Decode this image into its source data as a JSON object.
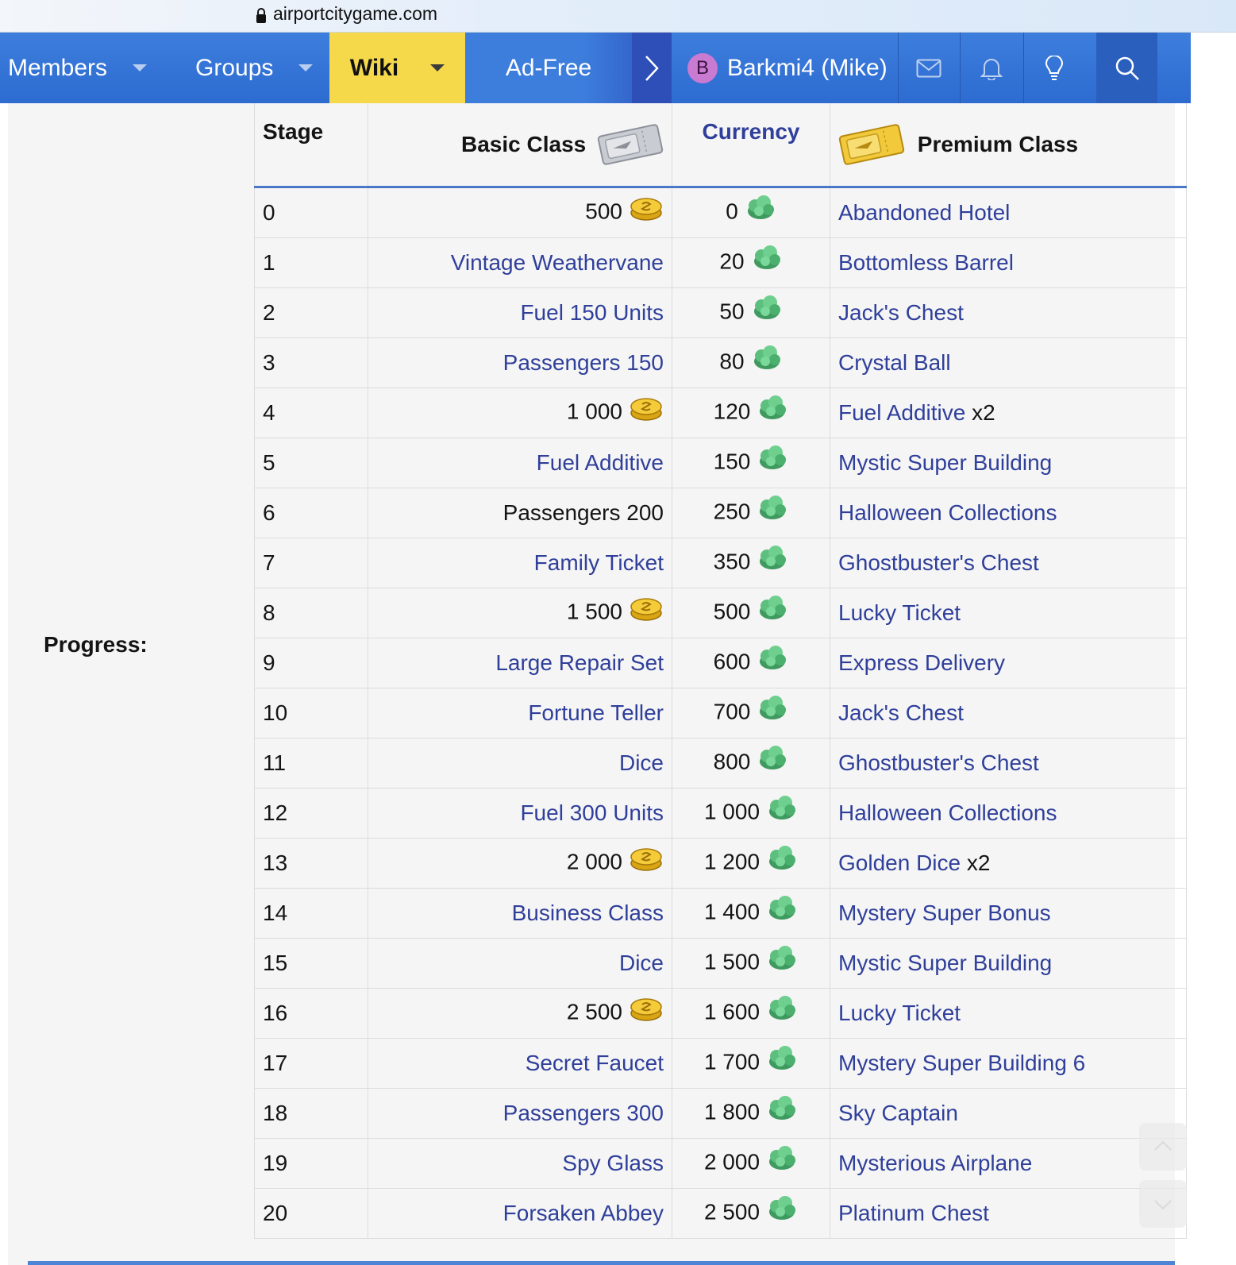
{
  "browser": {
    "url": "airportcitygame.com"
  },
  "nav": {
    "members": "Members",
    "groups": "Groups",
    "wiki": "Wiki",
    "adfree": "Ad-Free",
    "user_initial": "B",
    "user_name": "Barkmi4 (Mike)"
  },
  "icons": [
    "lock-icon",
    "chevron-down-icon",
    "chevron-right-icon",
    "mail-icon",
    "bell-icon",
    "lightbulb-icon",
    "search-icon",
    "silver-ticket-icon",
    "gold-ticket-icon",
    "coins-icon",
    "cash-icon",
    "arrow-up-icon",
    "arrow-down-icon"
  ],
  "colors": {
    "nav": "#3d7edd",
    "wiki_active": "#f5d94b",
    "link": "#2f3f9a",
    "header_rule": "#4a78c9"
  },
  "section": {
    "label": "Progress:"
  },
  "table": {
    "headers": {
      "stage": "Stage",
      "basic": "Basic Class",
      "currency": "Currency",
      "premium": "Premium Class"
    },
    "rows": [
      {
        "stage": "0",
        "basic": "500",
        "basic_coin": true,
        "basic_link": false,
        "currency": "0",
        "premium": "Abandoned Hotel",
        "premium_suffix": ""
      },
      {
        "stage": "1",
        "basic": "Vintage Weathervane",
        "basic_coin": false,
        "basic_link": true,
        "currency": "20",
        "premium": "Bottomless Barrel",
        "premium_suffix": ""
      },
      {
        "stage": "2",
        "basic": "Fuel 150 Units",
        "basic_coin": false,
        "basic_link": true,
        "currency": "50",
        "premium": "Jack's Chest",
        "premium_suffix": ""
      },
      {
        "stage": "3",
        "basic": "Passengers 150",
        "basic_coin": false,
        "basic_link": true,
        "currency": "80",
        "premium": "Crystal Ball",
        "premium_suffix": ""
      },
      {
        "stage": "4",
        "basic": "1 000",
        "basic_coin": true,
        "basic_link": false,
        "currency": "120",
        "premium": "Fuel Additive",
        "premium_suffix": " x2"
      },
      {
        "stage": "5",
        "basic": "Fuel Additive",
        "basic_coin": false,
        "basic_link": true,
        "currency": "150",
        "premium": "Mystic Super Building",
        "premium_suffix": ""
      },
      {
        "stage": "6",
        "basic": "Passengers 200",
        "basic_coin": false,
        "basic_link": false,
        "currency": "250",
        "premium": "Halloween Collections",
        "premium_suffix": ""
      },
      {
        "stage": "7",
        "basic": "Family Ticket",
        "basic_coin": false,
        "basic_link": true,
        "currency": "350",
        "premium": "Ghostbuster's Chest",
        "premium_suffix": ""
      },
      {
        "stage": "8",
        "basic": "1 500",
        "basic_coin": true,
        "basic_link": false,
        "currency": "500",
        "premium": "Lucky Ticket",
        "premium_suffix": ""
      },
      {
        "stage": "9",
        "basic": "Large Repair Set",
        "basic_coin": false,
        "basic_link": true,
        "currency": "600",
        "premium": "Express Delivery",
        "premium_suffix": ""
      },
      {
        "stage": "10",
        "basic": "Fortune Teller",
        "basic_coin": false,
        "basic_link": true,
        "currency": "700",
        "premium": "Jack's Chest",
        "premium_suffix": ""
      },
      {
        "stage": "11",
        "basic": "Dice",
        "basic_coin": false,
        "basic_link": true,
        "currency": "800",
        "premium": "Ghostbuster's Chest",
        "premium_suffix": ""
      },
      {
        "stage": "12",
        "basic": "Fuel 300 Units",
        "basic_coin": false,
        "basic_link": true,
        "currency": "1 000",
        "premium": "Halloween Collections",
        "premium_suffix": ""
      },
      {
        "stage": "13",
        "basic": "2 000",
        "basic_coin": true,
        "basic_link": false,
        "currency": "1 200",
        "premium": "Golden Dice",
        "premium_suffix": " x2"
      },
      {
        "stage": "14",
        "basic": "Business Class",
        "basic_coin": false,
        "basic_link": true,
        "currency": "1 400",
        "premium": "Mystery Super Bonus",
        "premium_suffix": ""
      },
      {
        "stage": "15",
        "basic": "Dice",
        "basic_coin": false,
        "basic_link": true,
        "currency": "1 500",
        "premium": "Mystic Super Building",
        "premium_suffix": ""
      },
      {
        "stage": "16",
        "basic": "2 500",
        "basic_coin": true,
        "basic_link": false,
        "currency": "1 600",
        "premium": "Lucky Ticket",
        "premium_suffix": ""
      },
      {
        "stage": "17",
        "basic": "Secret Faucet",
        "basic_coin": false,
        "basic_link": true,
        "currency": "1 700",
        "premium": "Mystery Super Building 6",
        "premium_suffix": ""
      },
      {
        "stage": "18",
        "basic": "Passengers 300",
        "basic_coin": false,
        "basic_link": true,
        "currency": "1 800",
        "premium": "Sky Captain",
        "premium_suffix": ""
      },
      {
        "stage": "19",
        "basic": "Spy Glass",
        "basic_coin": false,
        "basic_link": true,
        "currency": "2 000",
        "premium": "Mysterious Airplane",
        "premium_suffix": ""
      },
      {
        "stage": "20",
        "basic": "Forsaken Abbey",
        "basic_coin": false,
        "basic_link": true,
        "currency": "2 500",
        "premium": "Platinum Chest",
        "premium_suffix": ""
      }
    ]
  }
}
